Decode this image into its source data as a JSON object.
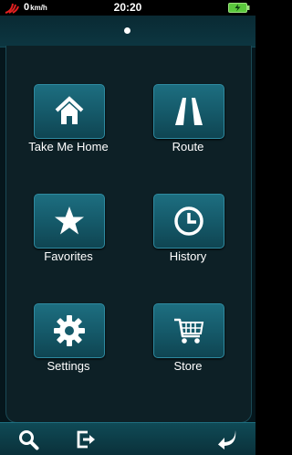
{
  "status_bar": {
    "speed_value": "0",
    "speed_unit": "km/h",
    "time": "20:20"
  },
  "menu": {
    "items": [
      {
        "label": "Take Me Home",
        "icon": "home-icon"
      },
      {
        "label": "Route",
        "icon": "road-icon"
      },
      {
        "label": "Favorites",
        "icon": "star-icon"
      },
      {
        "label": "History",
        "icon": "clock-icon"
      },
      {
        "label": "Settings",
        "icon": "gear-icon"
      },
      {
        "label": "Store",
        "icon": "cart-icon"
      }
    ]
  },
  "bottom_bar": {
    "icons": [
      "search-icon",
      "exit-icon",
      "back-arrow-icon"
    ]
  },
  "colors": {
    "tile": "#155a6a",
    "tile_border": "#2e8aa0",
    "panel": "#0d2026",
    "accent_red": "#e02020",
    "battery_green": "#5ac83c"
  }
}
